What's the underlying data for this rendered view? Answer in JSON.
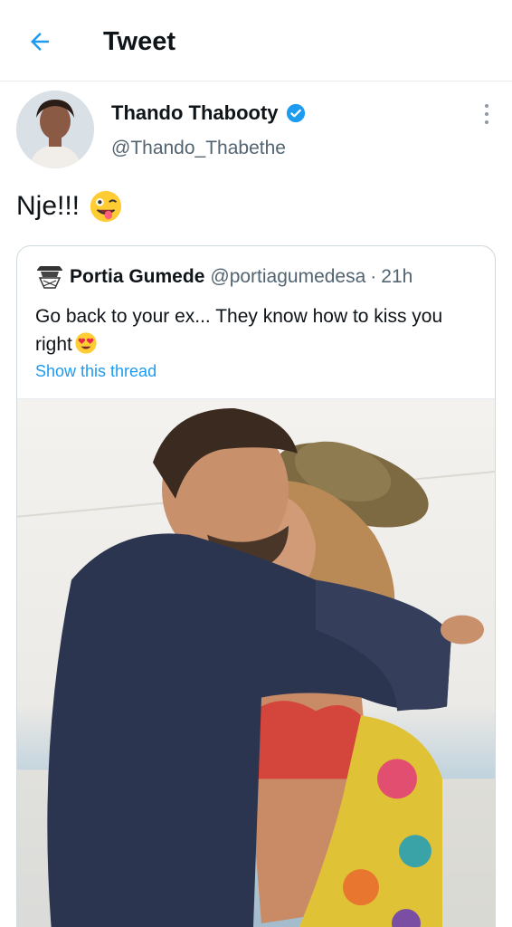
{
  "header": {
    "title": "Tweet",
    "back_icon": "arrow-left-icon",
    "accent": "#1d9bf0"
  },
  "tweet": {
    "author_name": "Thando Thabooty",
    "author_handle": "@Thando_Thabethe",
    "verified_icon": "verified-badge-icon",
    "more_icon": "more-vertical-icon",
    "text": "Nje!!!",
    "emoji": "zany-face-emoji"
  },
  "quoted_tweet": {
    "author_name": "Portia Gumede",
    "author_handle": "@portiagumedesa",
    "separator": "·",
    "time": "21h",
    "text": "Go back to your ex... They know how to kiss you right",
    "emoji": "heart-eyes-emoji",
    "show_thread": "Show this thread",
    "media": "photo"
  }
}
